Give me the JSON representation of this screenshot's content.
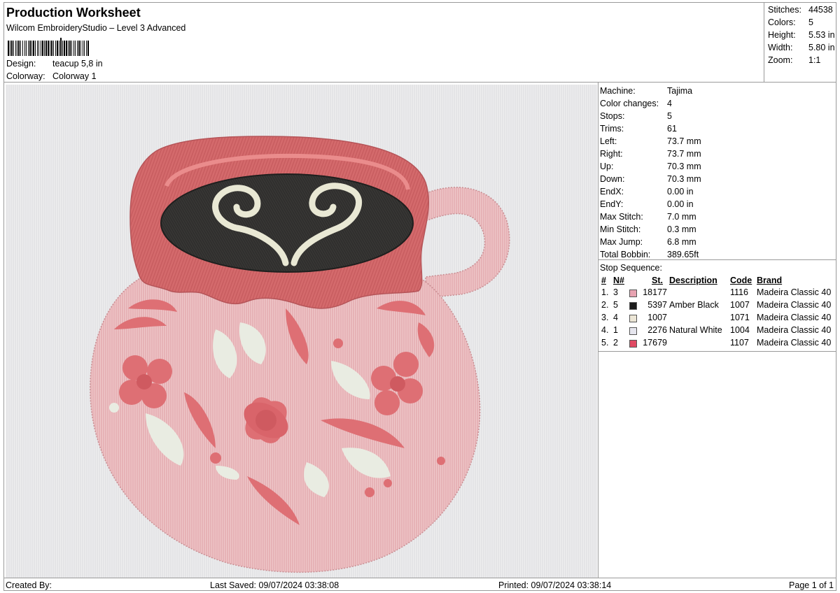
{
  "header": {
    "title": "Production Worksheet",
    "subtitle": "Wilcom EmbroideryStudio – Level 3 Advanced",
    "design_label": "Design:",
    "design_value": "teacup 5,8 in",
    "colorway_label": "Colorway:",
    "colorway_value": "Colorway 1"
  },
  "summary": {
    "stitches_label": "Stitches:",
    "stitches": "44538",
    "colors_label": "Colors:",
    "colors": "5",
    "height_label": "Height:",
    "height": "5.53 in",
    "width_label": "Width:",
    "width": "5.80 in",
    "zoom_label": "Zoom:",
    "zoom": "1:1"
  },
  "machine_info": [
    {
      "label": "Machine:",
      "value": "Tajima"
    },
    {
      "label": "Color changes:",
      "value": "4"
    },
    {
      "label": "Stops:",
      "value": "5"
    },
    {
      "label": "Trims:",
      "value": "61"
    },
    {
      "label": "Left:",
      "value": "73.7 mm"
    },
    {
      "label": "Right:",
      "value": "73.7 mm"
    },
    {
      "label": "Up:",
      "value": "70.3 mm"
    },
    {
      "label": "Down:",
      "value": "70.3 mm"
    },
    {
      "label": "EndX:",
      "value": "0.00 in"
    },
    {
      "label": "EndY:",
      "value": "0.00 in"
    },
    {
      "label": "Max Stitch:",
      "value": "7.0 mm"
    },
    {
      "label": "Min Stitch:",
      "value": "0.3 mm"
    },
    {
      "label": "Max Jump:",
      "value": "6.8 mm"
    },
    {
      "label": "Total Bobbin:",
      "value": "389.65ft"
    }
  ],
  "stop_sequence": {
    "title": "Stop Sequence:",
    "columns": {
      "num": "#",
      "n": "N#",
      "st": "St.",
      "description": "Description",
      "code": "Code",
      "brand": "Brand"
    },
    "rows": [
      {
        "num": "1.",
        "n": "3",
        "color": "#e7a3b1",
        "st": "18177",
        "description": "",
        "code": "1116",
        "brand": "Madeira Classic 40"
      },
      {
        "num": "2.",
        "n": "5",
        "color": "#1c1c1c",
        "st": "5397",
        "description": "Amber Black",
        "code": "1007",
        "brand": "Madeira Classic 40"
      },
      {
        "num": "3.",
        "n": "4",
        "color": "#ece6d6",
        "st": "1007",
        "description": "",
        "code": "1071",
        "brand": "Madeira Classic 40"
      },
      {
        "num": "4.",
        "n": "1",
        "color": "#e6e6ee",
        "st": "2276",
        "description": "Natural White",
        "code": "1004",
        "brand": "Madeira Classic 40"
      },
      {
        "num": "5.",
        "n": "2",
        "color": "#e04a63",
        "st": "17679",
        "description": "",
        "code": "1107",
        "brand": "Madeira Classic 40"
      }
    ]
  },
  "footer": {
    "created_by": "Created By:",
    "last_saved": "Last Saved: 09/07/2024 03:38:08",
    "printed": "Printed: 09/07/2024 03:38:14",
    "page": "Page 1 of 1"
  },
  "colors": {
    "cup_body": "#e9bcbf",
    "cup_rim": "#cd6667",
    "coffee": "#333331",
    "latte": "#e8e8d6",
    "flower": "#de6f74",
    "leaf": "#e9ece2",
    "background": "#e8e8ea"
  }
}
